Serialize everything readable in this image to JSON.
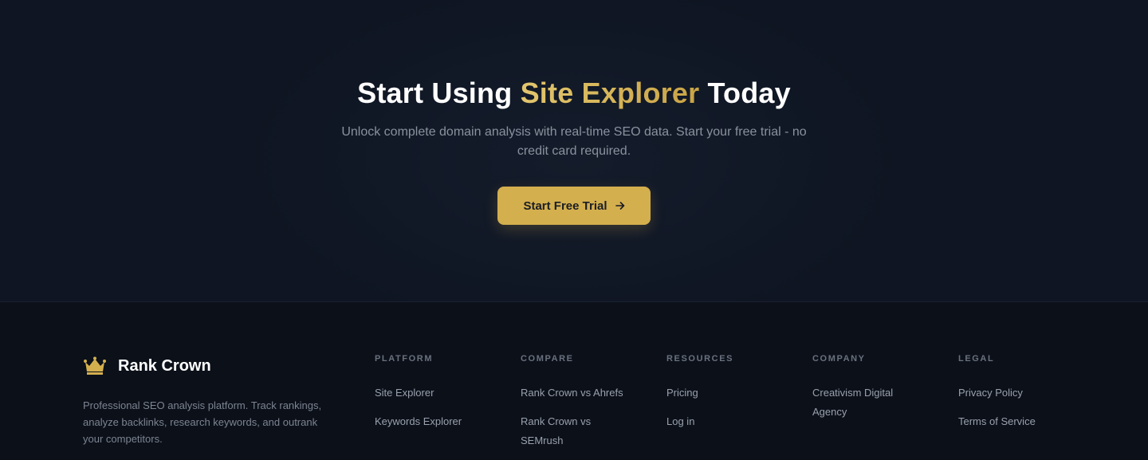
{
  "cta": {
    "title_part1": "Start Using ",
    "title_highlight": "Site Explorer",
    "title_part2": " Today",
    "subtitle": "Unlock complete domain analysis with real-time SEO data. Start your free trial - no credit card required.",
    "button_label": "Start Free Trial",
    "accent_color": "#d4af4e"
  },
  "footer": {
    "brand_name": "Rank Crown",
    "brand_icon": "crown-icon",
    "description": "Professional SEO analysis platform. Track rankings, analyze backlinks, research keywords, and outrank your competitors.",
    "columns": [
      {
        "title": "PLATFORM",
        "links": [
          "Site Explorer",
          "Keywords Explorer"
        ]
      },
      {
        "title": "COMPARE",
        "links": [
          "Rank Crown vs Ahrefs",
          "Rank Crown vs SEMrush"
        ]
      },
      {
        "title": "RESOURCES",
        "links": [
          "Pricing",
          "Log in"
        ]
      },
      {
        "title": "COMPANY",
        "links": [
          "Creativism Digital Agency"
        ]
      },
      {
        "title": "LEGAL",
        "links": [
          "Privacy Policy",
          "Terms of Service"
        ]
      }
    ]
  }
}
